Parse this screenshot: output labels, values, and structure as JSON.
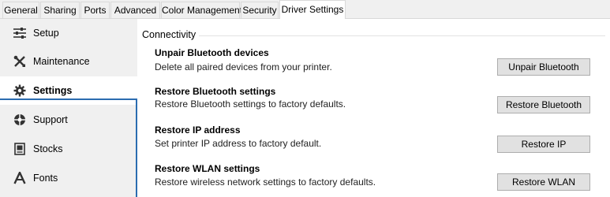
{
  "tabs": [
    "General",
    "Sharing",
    "Ports",
    "Advanced",
    "Color Management",
    "Security",
    "Driver Settings"
  ],
  "active_tab": "Driver Settings",
  "sidebar": {
    "items": [
      {
        "label": "Setup",
        "icon": "sliders-icon"
      },
      {
        "label": "Maintenance",
        "icon": "wrench-icon"
      },
      {
        "label": "Settings",
        "icon": "gear-icon"
      },
      {
        "label": "Support",
        "icon": "lifebuoy-icon"
      },
      {
        "label": "Stocks",
        "icon": "stocks-icon"
      },
      {
        "label": "Fonts",
        "icon": "font-icon"
      }
    ],
    "active": "Settings",
    "accent_color": "#2b6cb0"
  },
  "content": {
    "group_title": "Connectivity",
    "rows": [
      {
        "title": "Unpair Bluetooth devices",
        "description": "Delete all paired devices from your printer.",
        "button": "Unpair Bluetooth"
      },
      {
        "title": "Restore Bluetooth settings",
        "description": "Restore Bluetooth settings to factory defaults.",
        "button": "Restore Bluetooth"
      },
      {
        "title": "Restore IP address",
        "description": "Set printer IP address to factory default.",
        "button": "Restore IP"
      },
      {
        "title": "Restore WLAN settings",
        "description": "Restore wireless network settings to factory defaults.",
        "button": "Restore WLAN"
      }
    ]
  }
}
